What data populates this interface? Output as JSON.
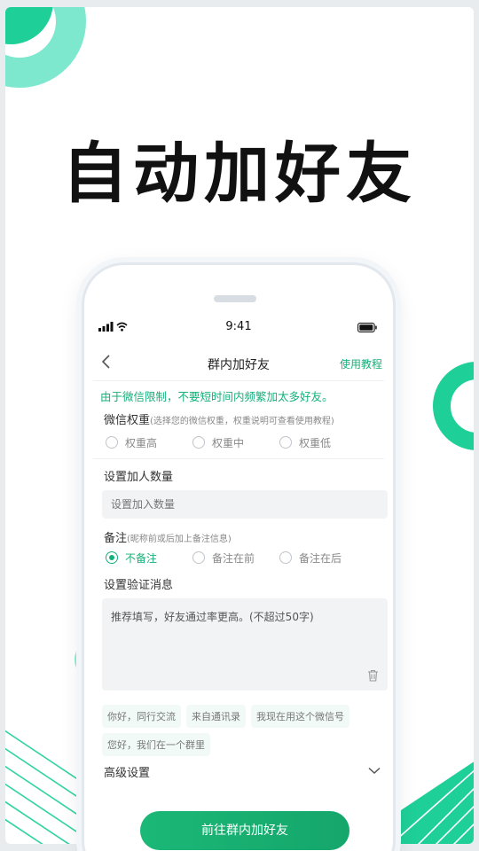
{
  "headline": "自动加好友",
  "colors": {
    "accent": "#16b07a",
    "deco_light": "#7ee8cf",
    "deco_dark": "#1fcf98"
  },
  "status_bar": {
    "time": "9:41",
    "icons": [
      "signal-icon",
      "wifi-icon",
      "battery-icon"
    ]
  },
  "nav": {
    "title": "群内加好友",
    "help": "使用教程",
    "back_icon": "chevron-left-icon"
  },
  "warning": "由于微信限制，不要短时间内频繁加太多好友。",
  "weight": {
    "label": "微信权重",
    "hint": "(选择您的微信权重，权重说明可查看使用教程)",
    "options": [
      "权重高",
      "权重中",
      "权重低"
    ]
  },
  "count": {
    "label": "设置加人数量",
    "placeholder": "设置加入数量"
  },
  "remark": {
    "label": "备注",
    "hint": "(昵称前或后加上备注信息)",
    "options": [
      "不备注",
      "备注在前",
      "备注在后"
    ],
    "selected": "不备注"
  },
  "verify": {
    "label": "设置验证消息",
    "placeholder": "推荐填写，好友通过率更高。(不超过50字)",
    "trash_icon": "trash-icon"
  },
  "chips": [
    "你好，同行交流",
    "来自通讯录",
    "我现在用这个微信号",
    "您好，我们在一个群里"
  ],
  "advanced": {
    "label": "高级设置",
    "icon": "chevron-down-icon"
  },
  "cta": "前往群内加好友"
}
